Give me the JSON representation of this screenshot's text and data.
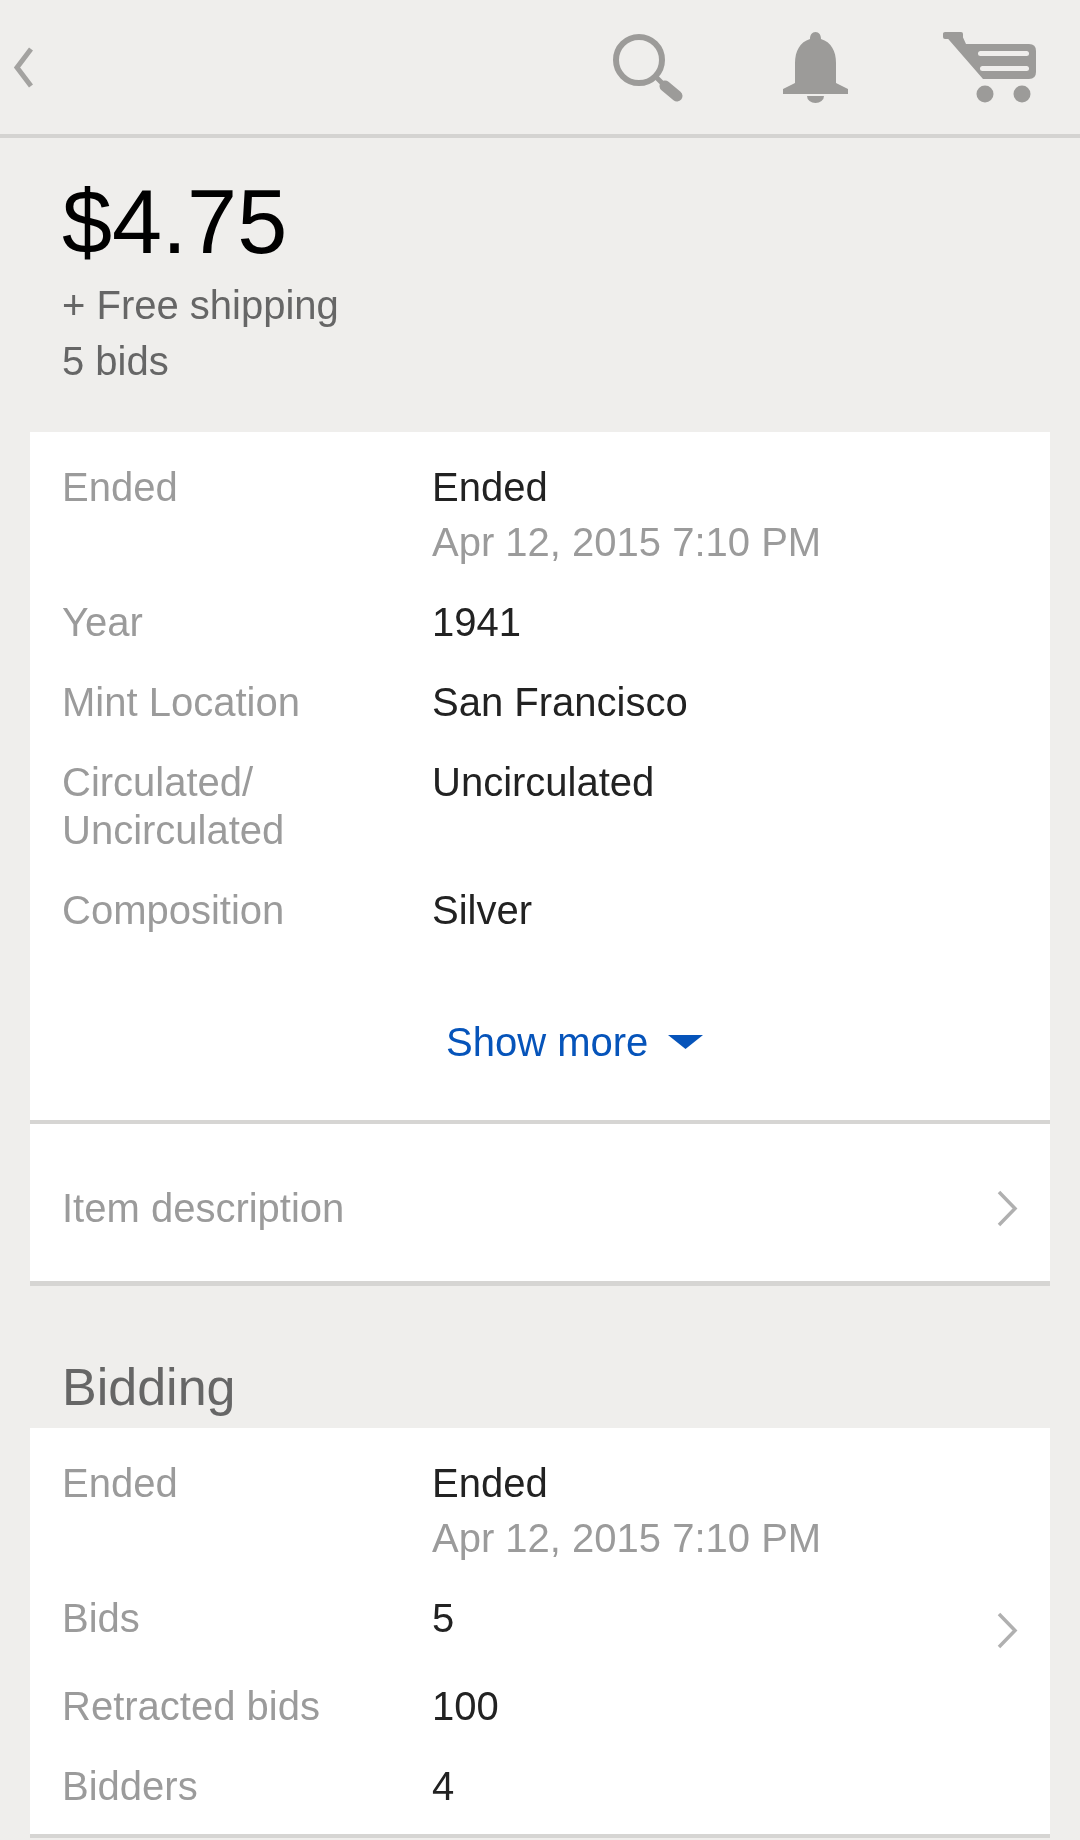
{
  "listing": {
    "price": "$4.75",
    "shipping": "+ Free shipping",
    "bids": "5 bids"
  },
  "specifics": {
    "rows": [
      {
        "label": "Ended",
        "value": "Ended",
        "detail": "Apr 12, 2015 7:10 PM"
      },
      {
        "label": "Year",
        "value": "1941"
      },
      {
        "label": "Mint Location",
        "value": "San Francisco"
      },
      {
        "label": "Circulated/Uncirculated",
        "value": "Uncirculated"
      },
      {
        "label": "Composition",
        "value": "Silver"
      }
    ],
    "show_more": {
      "label": "Show more",
      "expanded": false
    }
  },
  "item_description": {
    "label": "Item description"
  },
  "bidding": {
    "title": "Bidding",
    "rows": [
      {
        "label": "Ended",
        "value": "Ended",
        "detail": "Apr 12, 2015 7:10 PM",
        "kind": "text"
      },
      {
        "label": "Bids",
        "value": "5",
        "kind": "link"
      },
      {
        "label": "Retracted bids",
        "value": "100",
        "kind": "text"
      },
      {
        "label": "Bidders",
        "value": "4",
        "kind": "text"
      }
    ]
  }
}
